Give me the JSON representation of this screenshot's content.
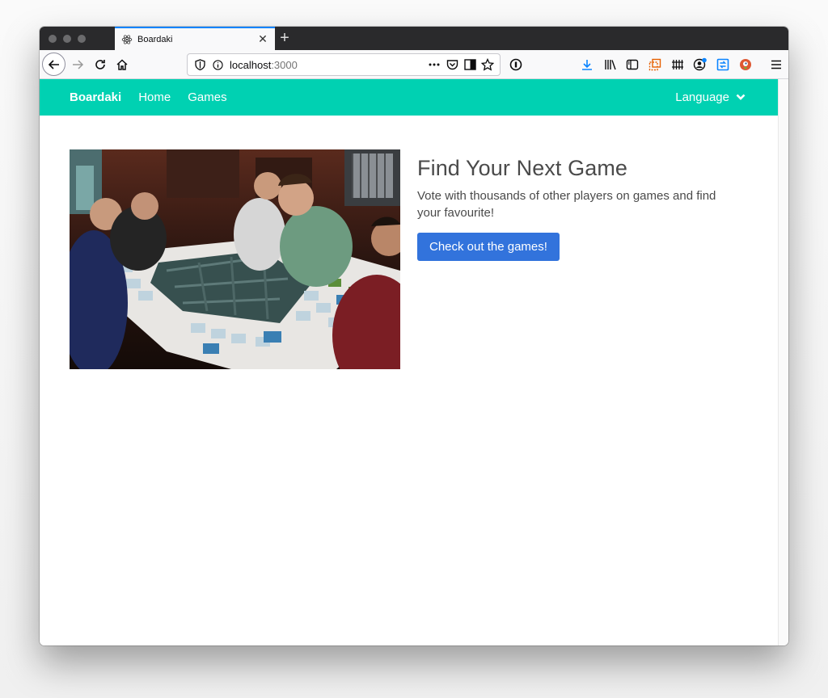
{
  "browser": {
    "tab_title": "Boardaki",
    "url_host": "localhost",
    "url_port": ":3000"
  },
  "navbar": {
    "brand": "Boardaki",
    "links": [
      "Home",
      "Games"
    ],
    "language_label": "Language"
  },
  "hero": {
    "title": "Find Your Next Game",
    "subtitle": "Vote with thousands of other players on games and find your favourite!",
    "cta_label": "Check out the games!"
  },
  "colors": {
    "navbar_bg": "#00d1b2",
    "cta_bg": "#3273dc",
    "tab_accent": "#0a84ff"
  },
  "icons": [
    "back-arrow-icon",
    "forward-arrow-icon",
    "reload-icon",
    "home-icon",
    "tracking-shield-icon",
    "info-icon",
    "page-actions-icon",
    "pocket-icon",
    "reader-view-icon",
    "bookmark-star-icon",
    "password-manager-icon",
    "download-icon",
    "library-icon",
    "sidebar-icon",
    "screenshot-icon",
    "extension-grid-icon",
    "account-icon",
    "sync-icon",
    "duckduckgo-icon",
    "hamburger-menu-icon",
    "react-favicon-icon",
    "close-tab-icon",
    "new-tab-icon",
    "chevron-down-icon"
  ]
}
